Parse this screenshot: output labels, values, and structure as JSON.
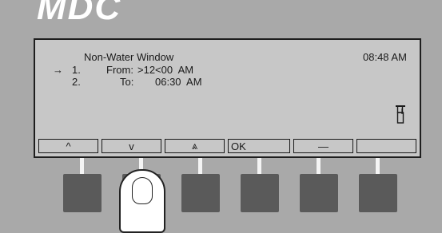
{
  "brand": {
    "logo": "MDC"
  },
  "display": {
    "title": "Non-Water Window",
    "clock": "08:48 AM",
    "rows": [
      {
        "pointer": "→",
        "number": "1.",
        "label": "From:",
        "value": ">12<00  AM"
      },
      {
        "pointer": "",
        "number": "2.",
        "label": "To:",
        "value": "06:30  AM"
      }
    ],
    "status_icon": "faucet-icon"
  },
  "softkeys": [
    {
      "label": "^",
      "icon": "caret-up-icon"
    },
    {
      "label": "v",
      "icon": "caret-down-icon"
    },
    {
      "label": "⩓",
      "icon": "double-caret-up-icon"
    },
    {
      "label": "OK",
      "icon": ""
    },
    {
      "label": "—",
      "icon": "minus-icon"
    },
    {
      "label": "",
      "icon": ""
    }
  ],
  "colors": {
    "panel": "#a9a9a9",
    "lcd": "#c7c7c7",
    "button": "#5a5a5a"
  }
}
